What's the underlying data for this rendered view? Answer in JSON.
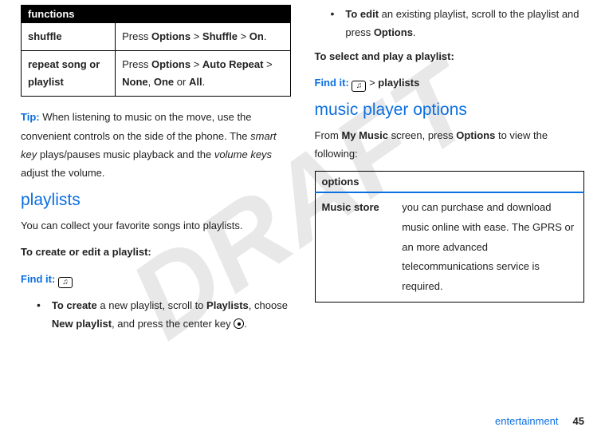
{
  "watermark": "DRAFT",
  "left": {
    "functions_header": "functions",
    "row1_label": "shuffle",
    "row1_p1": "Press ",
    "row1_options": "Options",
    "row1_gt1": " > ",
    "row1_shuffle": "Shuffle",
    "row1_gt2": " > ",
    "row1_on": "On",
    "row1_end": ".",
    "row2_label": "repeat song or playlist",
    "row2_p1": "Press ",
    "row2_options": "Options",
    "row2_gt1": " > ",
    "row2_auto": "Auto Repeat",
    "row2_gt2": " > ",
    "row2_none": "None",
    "row2_comma": ", ",
    "row2_one": "One",
    "row2_or": " or ",
    "row2_all": "All",
    "row2_end": ".",
    "tip_label": "Tip:",
    "tip_p1": " When listening to music on the move, use the convenient controls on the side of the phone. The ",
    "tip_smart": "smart key",
    "tip_p2": " plays/pauses music playback and the ",
    "tip_vol": "volume keys",
    "tip_p3": " adjust the volume.",
    "h_playlists": "playlists",
    "pl_intro": "You can collect your favorite songs into playlists.",
    "pl_create_edit": "To create or edit a playlist:",
    "find_label": "Find it:",
    "b1_strong": "To create",
    "b1_p1": " a new playlist, scroll to ",
    "b1_playlists": "Playlists",
    "b1_p2": ", choose ",
    "b1_new": "New playlist",
    "b1_p3": ", and press the center key ",
    "b1_end": "."
  },
  "right": {
    "b2_strong": "To edit",
    "b2_p1": " an existing playlist, scroll to the playlist and press ",
    "b2_options": "Options",
    "b2_end": ".",
    "select_play": "To select and play a playlist:",
    "find_label": "Find it:",
    "find_gt": " > ",
    "find_playlists": "playlists",
    "h_options": "music player options",
    "opt_p1": "From ",
    "opt_mymusic": "My Music",
    "opt_p2": " screen, press ",
    "opt_options": "Options",
    "opt_p3": " to view the following:",
    "options_header": "options",
    "row_label": "Music store",
    "row_desc": "you can purchase and download music online with ease. The GPRS or an more advanced telecommunications service is required."
  },
  "footer": {
    "section": "entertainment",
    "page": "45"
  }
}
